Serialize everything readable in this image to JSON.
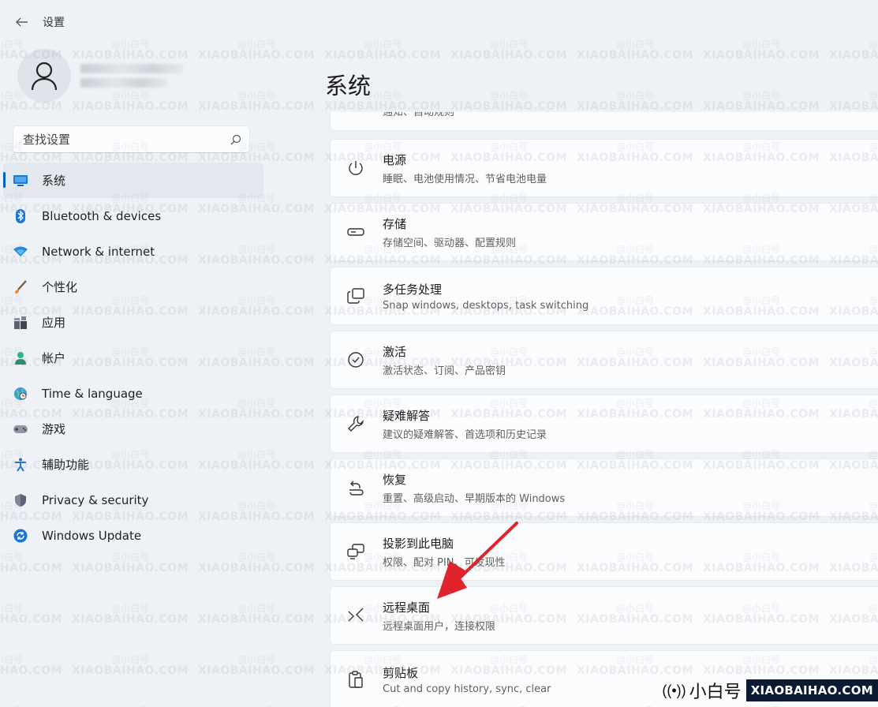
{
  "window": {
    "title": "设置",
    "back_label": "←"
  },
  "search": {
    "placeholder": "查找设置"
  },
  "sidebar": {
    "items": [
      {
        "label": "系统",
        "icon": "monitor-icon",
        "active": true
      },
      {
        "label": "Bluetooth & devices",
        "icon": "bluetooth-icon"
      },
      {
        "label": "Network & internet",
        "icon": "wifi-icon"
      },
      {
        "label": "个性化",
        "icon": "brush-icon"
      },
      {
        "label": "应用",
        "icon": "apps-icon"
      },
      {
        "label": "帐户",
        "icon": "person-icon"
      },
      {
        "label": "Time & language",
        "icon": "globe-clock-icon"
      },
      {
        "label": "游戏",
        "icon": "gamepad-icon"
      },
      {
        "label": "辅助功能",
        "icon": "accessibility-icon"
      },
      {
        "label": "Privacy & security",
        "icon": "shield-icon"
      },
      {
        "label": "Windows Update",
        "icon": "update-icon"
      }
    ]
  },
  "main": {
    "title": "系统",
    "partial_card_sub": "通知、自动规则",
    "cards": [
      {
        "title": "电源",
        "sub": "睡眠、电池使用情况、节省电池电量",
        "icon": "power-icon"
      },
      {
        "title": "存储",
        "sub": "存储空间、驱动器、配置规则",
        "icon": "storage-icon"
      },
      {
        "title": "多任务处理",
        "sub": "Snap windows, desktops, task switching",
        "icon": "multitask-icon"
      },
      {
        "title": "激活",
        "sub": "激活状态、订阅、产品密钥",
        "icon": "activation-icon"
      },
      {
        "title": "疑难解答",
        "sub": "建议的疑难解答、首选项和历史记录",
        "icon": "wrench-icon"
      },
      {
        "title": "恢复",
        "sub": "重置、高级启动、早期版本的 Windows",
        "icon": "recovery-icon"
      },
      {
        "title": "投影到此电脑",
        "sub": "权限、配对 PIN、可发现性",
        "icon": "project-icon"
      },
      {
        "title": "远程桌面",
        "sub": "远程桌面用户，连接权限",
        "icon": "remote-desktop-icon"
      },
      {
        "title": "剪贴板",
        "sub": "Cut and copy history, sync, clear",
        "icon": "clipboard-icon"
      }
    ]
  },
  "watermark": {
    "line1": "@小白号",
    "line2": "XIAOBAIHAO.COM"
  },
  "brand": {
    "signal": "((•))",
    "cn": "小白号",
    "en": "XIAOBAIHAO.COM"
  },
  "colors": {
    "accent": "#0067c0",
    "arrow": "#e0242b"
  }
}
